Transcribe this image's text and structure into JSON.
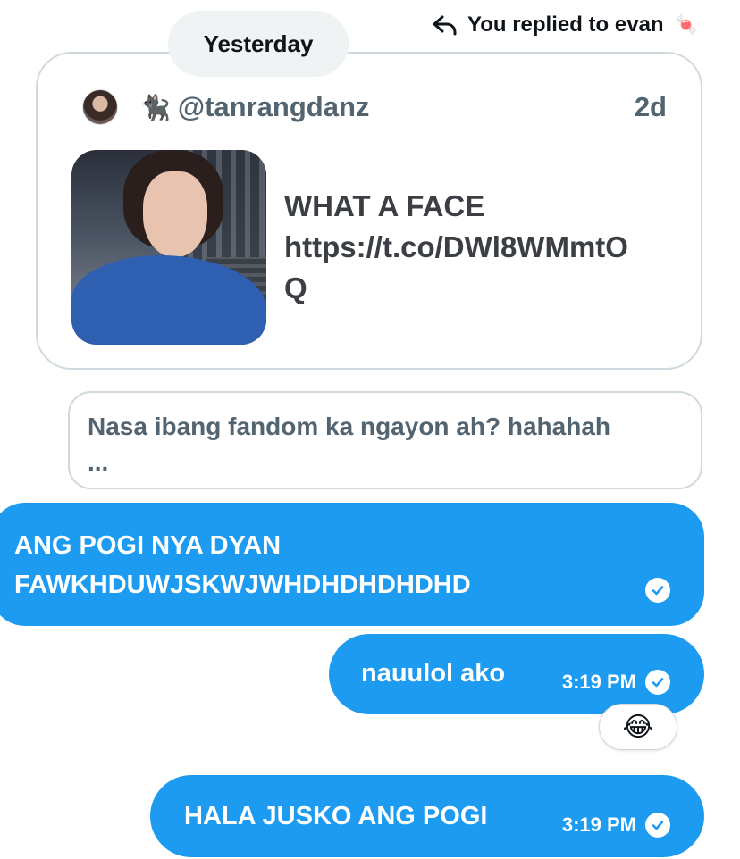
{
  "reply_context": {
    "text": "You replied to evan",
    "icon": "reply-arrow-icon",
    "emoji": "🍬"
  },
  "date_separator": "Yesterday",
  "quoted_tweet": {
    "avatar": "profile-avatar",
    "emoji": "🐈‍⬛",
    "handle": "@tanrangdanz",
    "age": "2d",
    "text": "WHAT A FACE\nhttps://t.co/DWl8WMmtO\nQ",
    "media": "photo of a person in a blue shirt"
  },
  "reply_preview": {
    "text": "Nasa ibang fandom ka ngayon ah? hahahah\n..."
  },
  "messages": [
    {
      "text": "ANG POGI NYA DYAN\nFAWKHDUWJSKWJWHDHDHDHDHD",
      "time": "",
      "status": "sent"
    },
    {
      "text": "nauulol ako",
      "time": "3:19 PM",
      "status": "sent",
      "reaction": "😂"
    },
    {
      "text": "HALA JUSKO ANG POGI",
      "time": "3:19 PM",
      "status": "sent"
    }
  ],
  "colors": {
    "bubble": "#1d9bf0",
    "border": "#cfd9de",
    "muted": "#536471",
    "pill": "#eff3f4"
  }
}
